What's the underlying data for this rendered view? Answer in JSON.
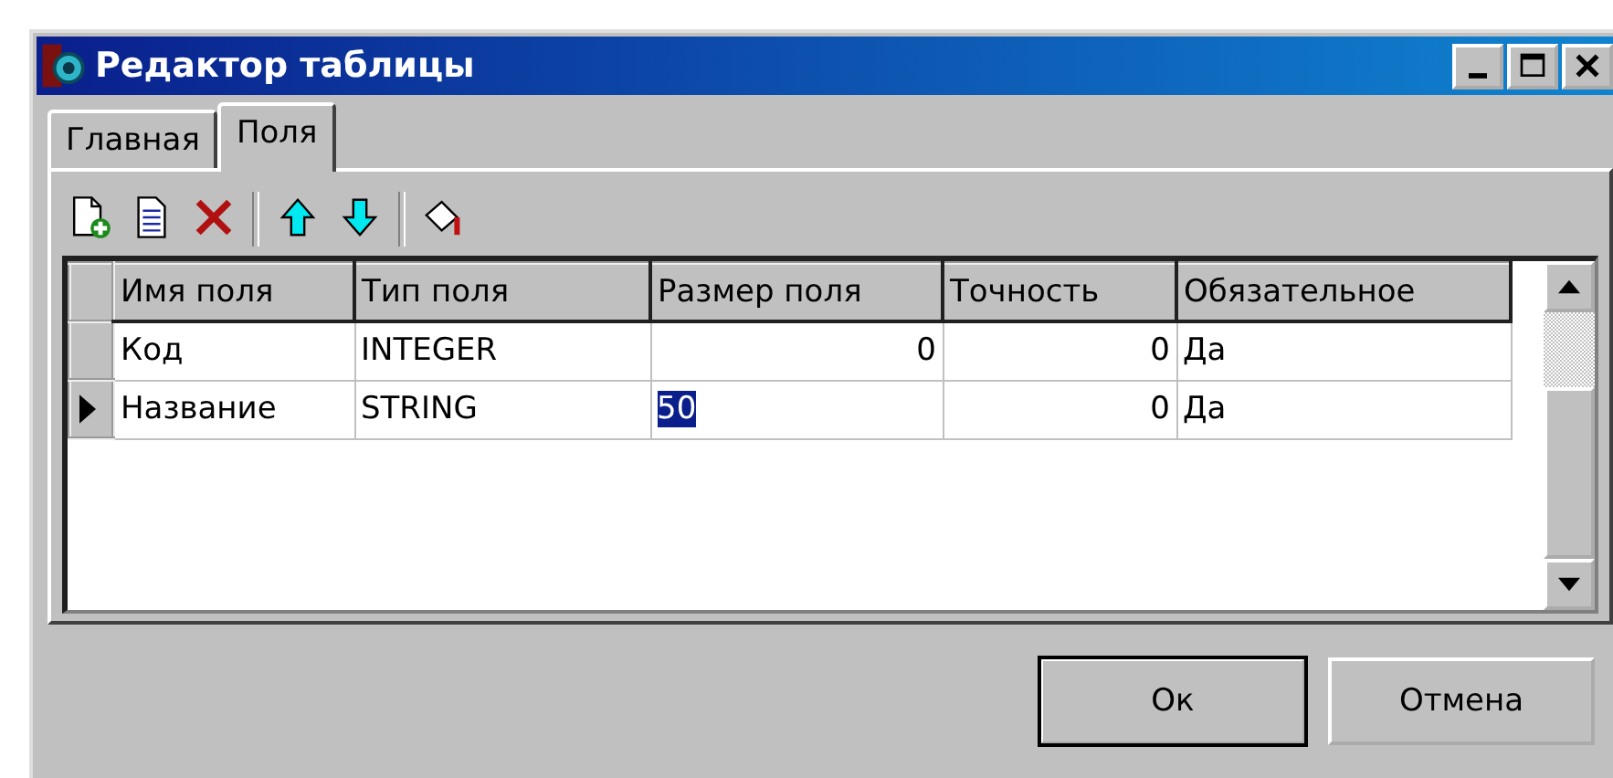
{
  "window": {
    "title": "Редактор таблицы"
  },
  "tabs": [
    {
      "label": "Главная",
      "selected": false
    },
    {
      "label": "Поля",
      "selected": true
    }
  ],
  "toolbar": [
    {
      "kind": "new"
    },
    {
      "kind": "edit"
    },
    {
      "kind": "delete"
    },
    {
      "kind": "separator"
    },
    {
      "kind": "up"
    },
    {
      "kind": "down"
    },
    {
      "kind": "separator"
    },
    {
      "kind": "fill"
    }
  ],
  "table": {
    "columns": [
      {
        "label": "Имя поля",
        "kind": "text"
      },
      {
        "label": "Тип поля",
        "kind": "text"
      },
      {
        "label": "Размер поля",
        "kind": "number"
      },
      {
        "label": "Точность",
        "kind": "number"
      },
      {
        "label": "Обязательное",
        "kind": "text"
      }
    ],
    "rows": [
      {
        "current": false,
        "cells": [
          {
            "text": "Код",
            "selected": false
          },
          {
            "text": "INTEGER",
            "selected": false
          },
          {
            "text": "0",
            "selected": false
          },
          {
            "text": "0",
            "selected": false
          },
          {
            "text": "Да",
            "selected": false
          }
        ]
      },
      {
        "current": true,
        "cells": [
          {
            "text": "Название",
            "selected": false
          },
          {
            "text": "STRING",
            "selected": false
          },
          {
            "text": "50",
            "selected": true
          },
          {
            "text": "0",
            "selected": false
          },
          {
            "text": "Да",
            "selected": false
          }
        ]
      }
    ]
  },
  "buttons": [
    {
      "label": "Ок",
      "default": true
    },
    {
      "label": "Отмена",
      "default": false
    }
  ]
}
